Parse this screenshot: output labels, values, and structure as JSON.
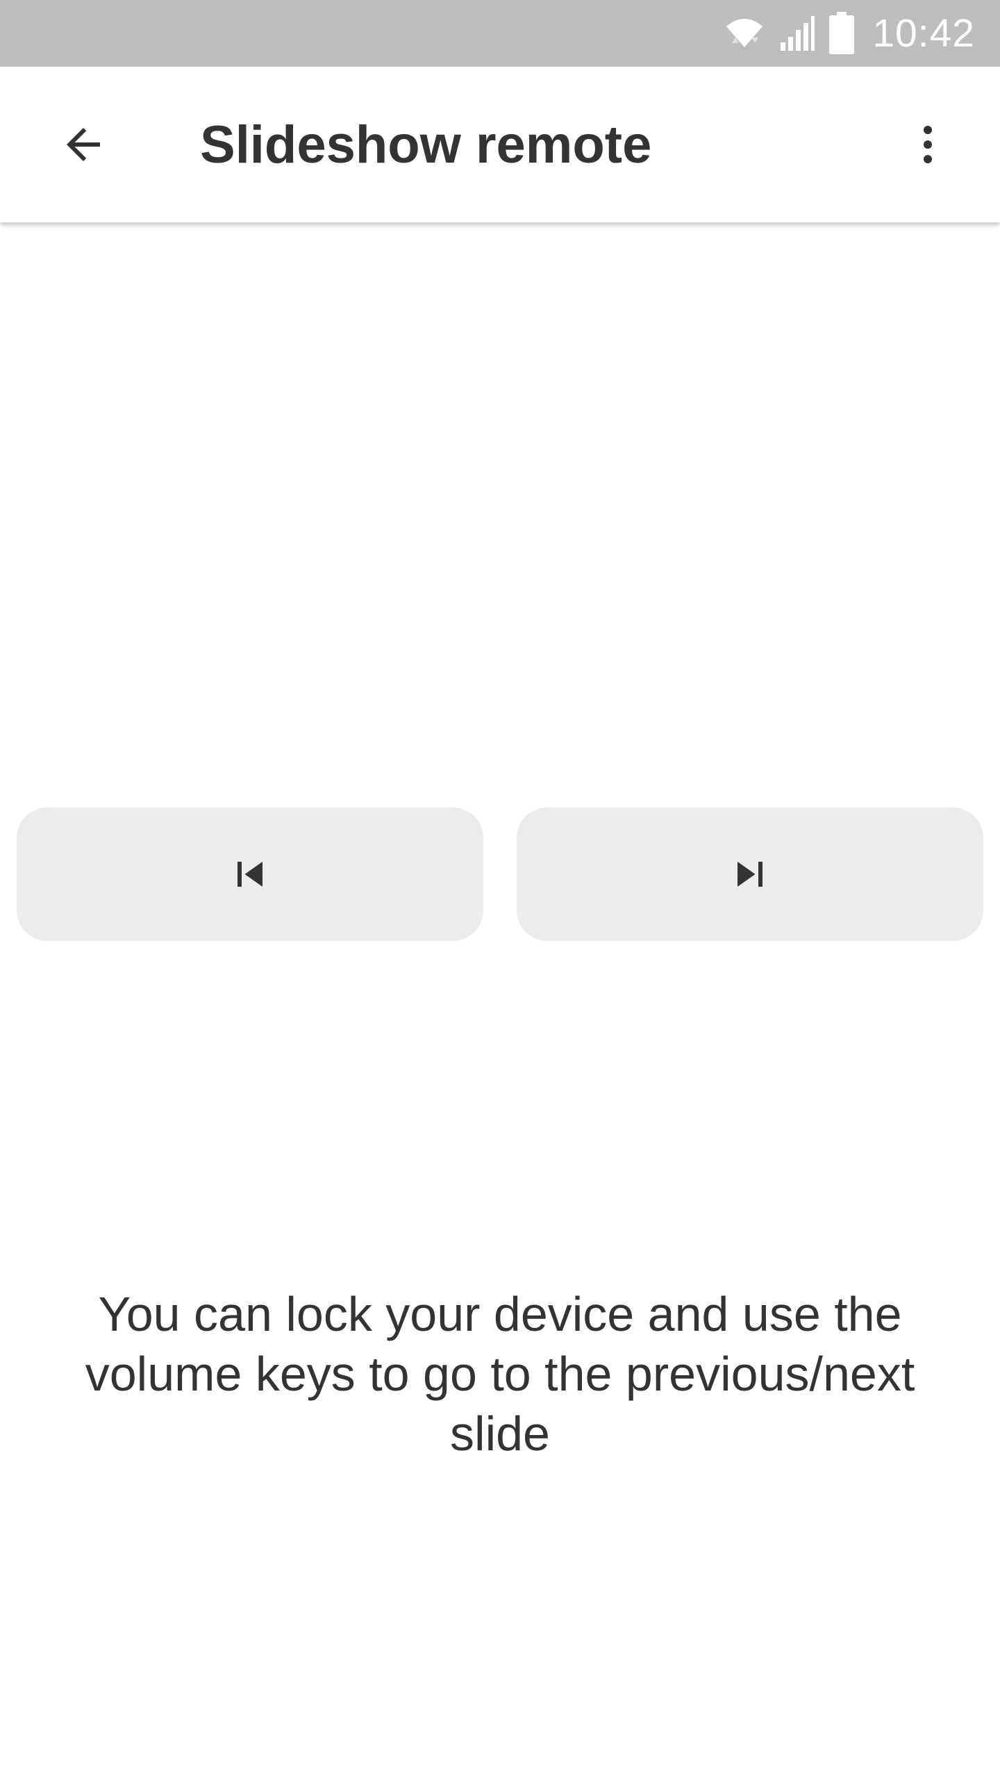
{
  "status_bar": {
    "time": "10:42",
    "icons": [
      "wifi-icon",
      "cellular-signal-icon",
      "battery-icon"
    ]
  },
  "app_bar": {
    "title": "Slideshow remote",
    "back_icon": "arrow-back-icon",
    "menu_icon": "more-vert-icon"
  },
  "controls": {
    "previous_icon": "skip-previous-icon",
    "next_icon": "skip-next-icon",
    "button_color": "#ececec"
  },
  "hint_text": "You can lock your device and use the volume keys to go to the previous/next slide",
  "colors": {
    "status_bar": "#bdbdbd",
    "text": "#333333",
    "background": "#ffffff"
  }
}
